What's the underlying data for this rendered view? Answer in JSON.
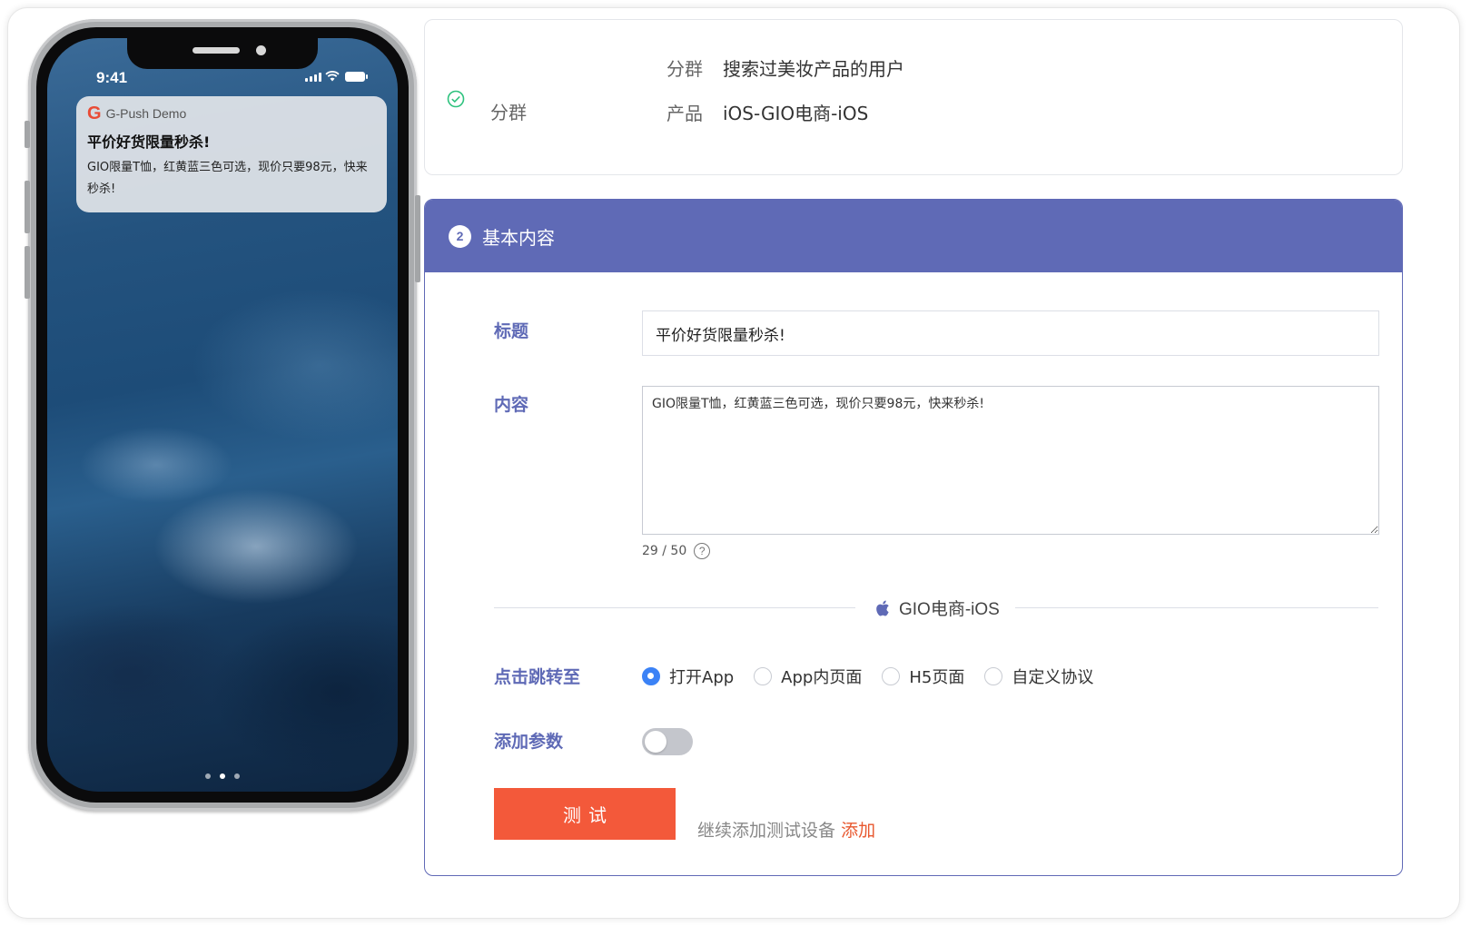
{
  "phone": {
    "status_time": "9:41",
    "notification": {
      "app_name": "G-Push Demo",
      "logo_letter": "G",
      "title": "平价好货限量秒杀!",
      "body": "GIO限量T恤，红黄蓝三色可选，现价只要98元，快来秒杀!"
    }
  },
  "step1": {
    "icon": "check-circle-icon",
    "label": "分群",
    "rows": [
      {
        "key": "分群",
        "value": "搜索过美妆产品的用户"
      },
      {
        "key": "产品",
        "value": "iOS-GIO电商-iOS"
      }
    ]
  },
  "step2": {
    "number": "2",
    "title": "基本内容",
    "title_label": "标题",
    "title_value": "平价好货限量秒杀!",
    "content_label": "内容",
    "content_value": "GIO限量T恤，红黄蓝三色可选，现价只要98元，快来秒杀!",
    "counter": "29 / 50",
    "help_glyph": "?",
    "platform": {
      "icon": "apple-icon",
      "name": "GIO电商-iOS"
    },
    "jump_label": "点击跳转至",
    "jump_options": [
      "打开App",
      "App内页面",
      "H5页面",
      "自定义协议"
    ],
    "jump_selected": "打开App",
    "params_label": "添加参数",
    "params_enabled": false,
    "test_button": "测试",
    "more_text": "继续添加测试设备",
    "more_link": "添加"
  },
  "colors": {
    "accent": "#5f6ab6",
    "primary_button": "#f3593a",
    "radio_selected": "#3b82f6",
    "success": "#2ec27e",
    "link": "#e8582f"
  }
}
